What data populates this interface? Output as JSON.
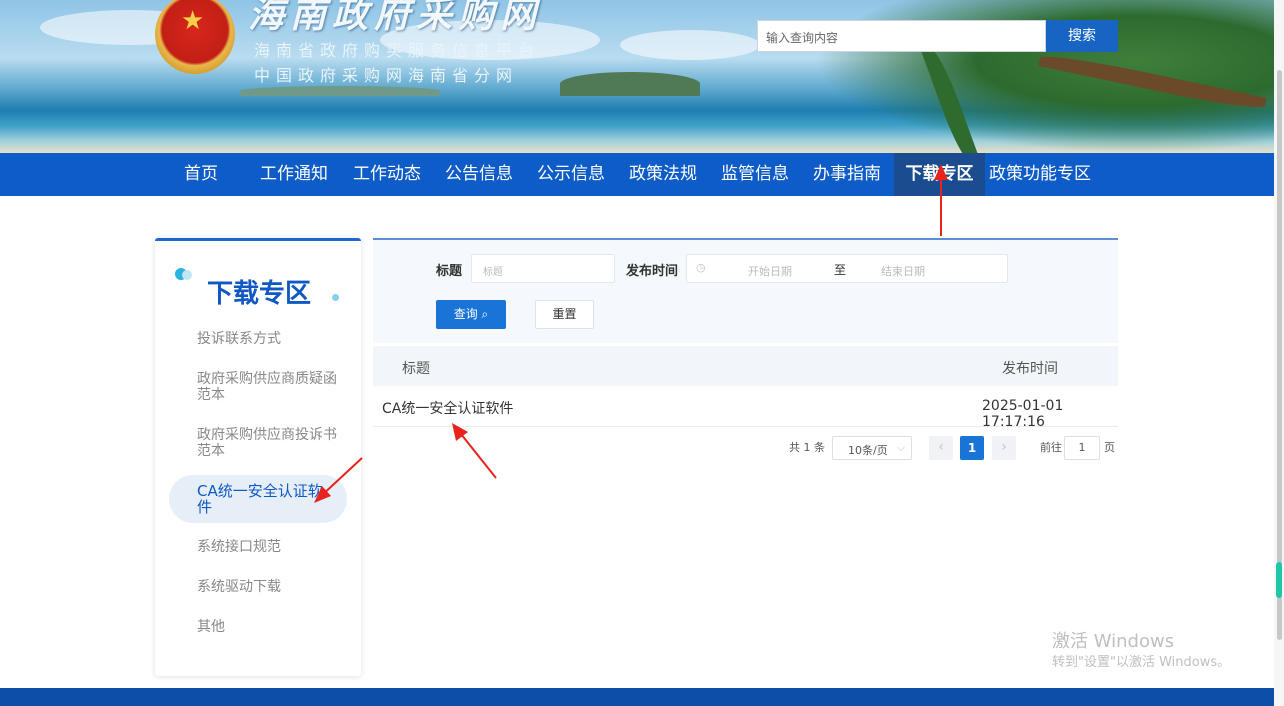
{
  "header": {
    "site_title": "海南政府采购网",
    "subtitle_1": "海南省政府购买服务信息平台",
    "subtitle_2": "中国政府采购网海南省分网",
    "search_placeholder": "输入查询内容",
    "search_button": "搜索"
  },
  "nav": {
    "items": [
      {
        "label": "首页"
      },
      {
        "label": "工作通知"
      },
      {
        "label": "工作动态"
      },
      {
        "label": "公告信息"
      },
      {
        "label": "公示信息"
      },
      {
        "label": "政策法规"
      },
      {
        "label": "监管信息"
      },
      {
        "label": "办事指南"
      },
      {
        "label": "下载专区",
        "active": true
      },
      {
        "label": "政策功能专区"
      }
    ]
  },
  "sidebar": {
    "title": "下载专区",
    "items": [
      {
        "label": "投诉联系方式"
      },
      {
        "label": "政府采购供应商质疑函范本"
      },
      {
        "label": "政府采购供应商投诉书范本"
      },
      {
        "label": "CA统一安全认证软件",
        "active": true
      },
      {
        "label": "系统接口规范"
      },
      {
        "label": "系统驱动下载"
      },
      {
        "label": "其他"
      }
    ]
  },
  "filter": {
    "title_label": "标题",
    "title_placeholder": "标题",
    "date_label": "发布时间",
    "start_placeholder": "开始日期",
    "date_sep": "至",
    "end_placeholder": "结束日期",
    "query_button": "查询",
    "reset_button": "重置"
  },
  "table": {
    "columns": [
      "标题",
      "发布时间"
    ],
    "rows": [
      {
        "title": "CA统一安全认证软件",
        "date": "2025-01-01 17:17:16"
      }
    ]
  },
  "pagination": {
    "total": "共 1 条",
    "page_size": "10条/页",
    "current_page": "1",
    "goto_label": "前往",
    "goto_value": "1",
    "page_suffix": "页"
  },
  "watermark": {
    "line1": "激活 Windows",
    "line2": "转到\"设置\"以激活 Windows。"
  },
  "colors": {
    "nav_bg": "#0d5cc7",
    "nav_active": "#1a4c8f",
    "accent": "#1a73d6",
    "annotation_arrow": "#e8231c"
  }
}
